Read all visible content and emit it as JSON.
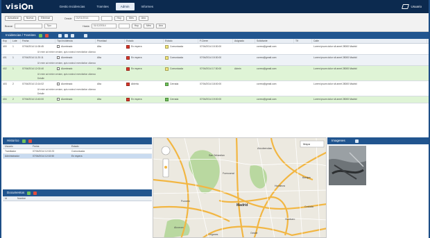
{
  "app": {
    "logo": "visi",
    "logo_suffix": "n",
    "nav": [
      "Gestio Incidencias",
      "Tramites",
      "Admin",
      "Informes"
    ],
    "active_nav_index": 2,
    "user": "Usuario"
  },
  "filters": {
    "row1_buttons": [
      "Actualizar",
      "Nueva",
      "Eliminar"
    ],
    "row1_label": "Desde",
    "row1_value": "01/01/2014",
    "row1_buttons2": [
      "Hoy",
      "Mes",
      "Ano"
    ],
    "row2_label": "Buscar",
    "row2_value": "",
    "row2_select": "Tipo",
    "row2_label2": "Hasta",
    "row2_value2": "31/12/2014",
    "row2_buttons2": [
      "Hoy",
      "Mes",
      "Ano"
    ]
  },
  "incidencias": {
    "title": "Incidencias / Tramites",
    "columns": [
      "Exp",
      "Lote",
      "Fecha",
      "Tipo Incidencia",
      "Prioridad",
      "Estado",
      "Estado",
      "F.Cierre",
      "Asignado",
      "Solicitante",
      "Tlf",
      "Calle"
    ],
    "rows": [
      {
        "exp": "400",
        "lote": "1",
        "fecha": "07/04/2014 11:08:45",
        "tipo": "Alumbrado",
        "prio": "Alta",
        "estado": "En espera",
        "estado2": "Comunicada",
        "fcierre": "07/04/2014 15:30:00",
        "asig": "",
        "email": "correo@gmail.com",
        "tlf": "",
        "calle": "Lorem ipsum dolor sit amet 28000 Madrid",
        "desc": "Ut enim ad minim veniam, quis nostrud exercitation ullamco",
        "extra": "",
        "style": "",
        "c1": "#d9372b",
        "c2": "#f3e67a"
      },
      {
        "exp": "401",
        "lote": "1",
        "fecha": "07/04/2014 11:20:11",
        "tipo": "Alumbrado",
        "prio": "Alta",
        "estado": "En espera",
        "estado2": "Comunicada",
        "fcierre": "07/04/2014 15:30:00",
        "asig": "",
        "email": "correo@gmail.com",
        "tlf": "",
        "calle": "Lorem ipsum dolor sit amet 28000 Madrid",
        "desc": "Ut enim ad minim veniam, quis nostrud exercitation ullamco",
        "extra": "",
        "style": "alt",
        "c1": "#d9372b",
        "c2": "#f3e67a"
      },
      {
        "exp": "402",
        "lote": "1",
        "fecha": "07/04/2014 12:02:40",
        "tipo": "Alumbrado",
        "prio": "Alta",
        "estado": "En espera",
        "estado2": "Comunicada",
        "fcierre": "07/04/2014 17:30:00",
        "asig": "Admin",
        "email": "correo@gmail.com",
        "tlf": "",
        "calle": "Lorem ipsum dolor sit amet 28000 Madrid",
        "desc": "Ut enim ad minim veniam, quis nostrud exercitation ullamco",
        "extra": "Detalle",
        "style": "green",
        "c1": "#d9372b",
        "c2": "#f3e67a"
      },
      {
        "exp": "403",
        "lote": "2",
        "fecha": "07/04/2014 13:14:02",
        "tipo": "Alumbrado",
        "prio": "Alta",
        "estado": "Abierta",
        "estado2": "Cerrada",
        "fcierre": "07/04/2014 18:00:00",
        "asig": "",
        "email": "correo@gmail.com",
        "tlf": "",
        "calle": "Lorem ipsum dolor sit amet 28000 Madrid",
        "desc": "Ut enim ad minim veniam, quis nostrud exercitation ullamco",
        "extra": "Detalle",
        "style": "",
        "c1": "#d9372b",
        "c2": "#6fc25a"
      },
      {
        "exp": "404",
        "lote": "2",
        "fecha": "07/04/2014 13:40:00",
        "tipo": "Alumbrado",
        "prio": "Alta",
        "estado": "En espera",
        "estado2": "Cerrada",
        "fcierre": "07/04/2014 19:00:00",
        "asig": "",
        "email": "correo@gmail.com",
        "tlf": "",
        "calle": "Lorem ipsum dolor sit amet 28000 Madrid",
        "desc": "",
        "extra": "",
        "style": "green",
        "c1": "#d9372b",
        "c2": "#6fc25a"
      }
    ]
  },
  "historico": {
    "title": "Historico",
    "columns": [
      "Usuario",
      "Fecha",
      "Estado"
    ],
    "rows": [
      {
        "u": "Tramitador",
        "f": "07/04/2014 12:02:23",
        "e": "Comunicada"
      },
      {
        "u": "Administrador",
        "f": "07/04/2014 12:02:50",
        "e": "En espera"
      }
    ]
  },
  "documentos": {
    "title": "Documentos",
    "columns": [
      "Id",
      "Nombre"
    ]
  },
  "imagenes": {
    "title": "Imagenes"
  },
  "map": {
    "labels": [
      "Alcobendas",
      "San Sebastian",
      "Fuencarral",
      "Hortaleza",
      "Barajas",
      "Madrid",
      "Coslada",
      "Pozuelo",
      "Vicalvaro",
      "Alcorcon",
      "Leganes",
      "Getafe"
    ],
    "map_type": "Mapa",
    "colors": {
      "road": "#f2b642",
      "park": "#b9d8a0",
      "land": "#ece9e0"
    }
  }
}
